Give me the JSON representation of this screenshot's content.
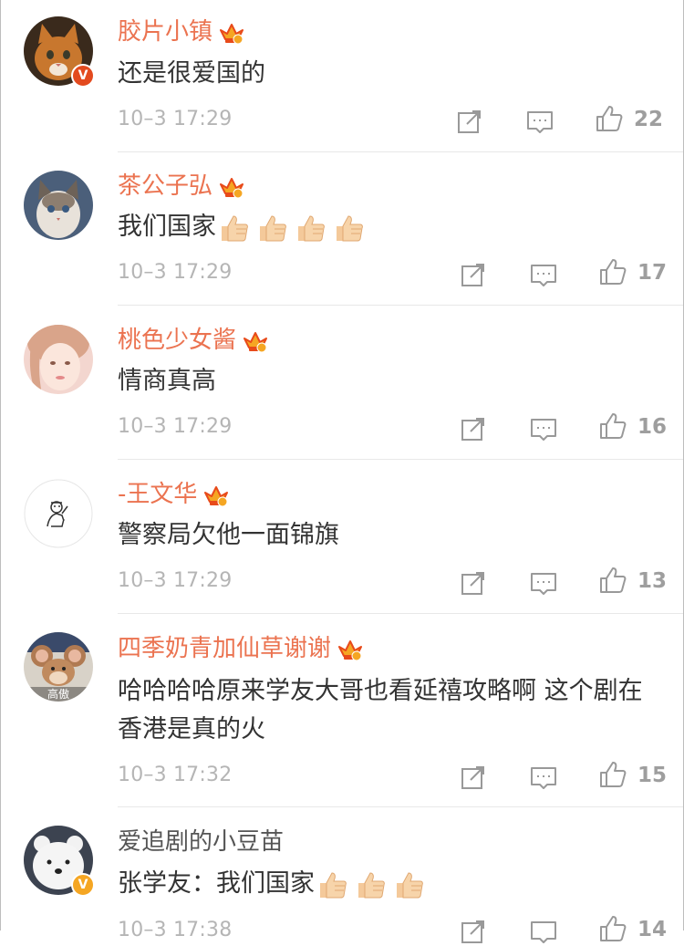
{
  "comments": [
    {
      "name": "胶片小镇",
      "vip": true,
      "verified": "red",
      "text": "还是很爱国的",
      "thumbs": 0,
      "time": "10–3 17:29",
      "likes": "22"
    },
    {
      "name": "茶公子弘",
      "vip": true,
      "verified": "",
      "text": "我们国家",
      "thumbs": 4,
      "time": "10–3 17:29",
      "likes": "17"
    },
    {
      "name": "桃色少女酱",
      "vip": true,
      "verified": "",
      "text": "情商真高",
      "thumbs": 0,
      "time": "10–3 17:29",
      "likes": "16"
    },
    {
      "name": "-王文华",
      "vip": true,
      "verified": "",
      "text": "警察局欠他一面锦旗",
      "thumbs": 0,
      "time": "10–3 17:29",
      "likes": "13"
    },
    {
      "name": "四季奶青加仙草谢谢",
      "vip": true,
      "verified": "",
      "avatar_label": "高傲",
      "text": "哈哈哈哈原来学友大哥也看延禧攻略啊 这个剧在香港是真的火",
      "thumbs": 0,
      "time": "10–3 17:32",
      "likes": "15"
    },
    {
      "name": "爱追剧的小豆苗",
      "vip": false,
      "verified": "gold",
      "text": "张学友：我们国家",
      "thumbs": 3,
      "time": "10–3 17:38",
      "likes": "14"
    }
  ],
  "badge_letter": "V",
  "colors": {
    "name": "#eb7350",
    "text": "#333333",
    "meta": "#b5b5b5"
  }
}
